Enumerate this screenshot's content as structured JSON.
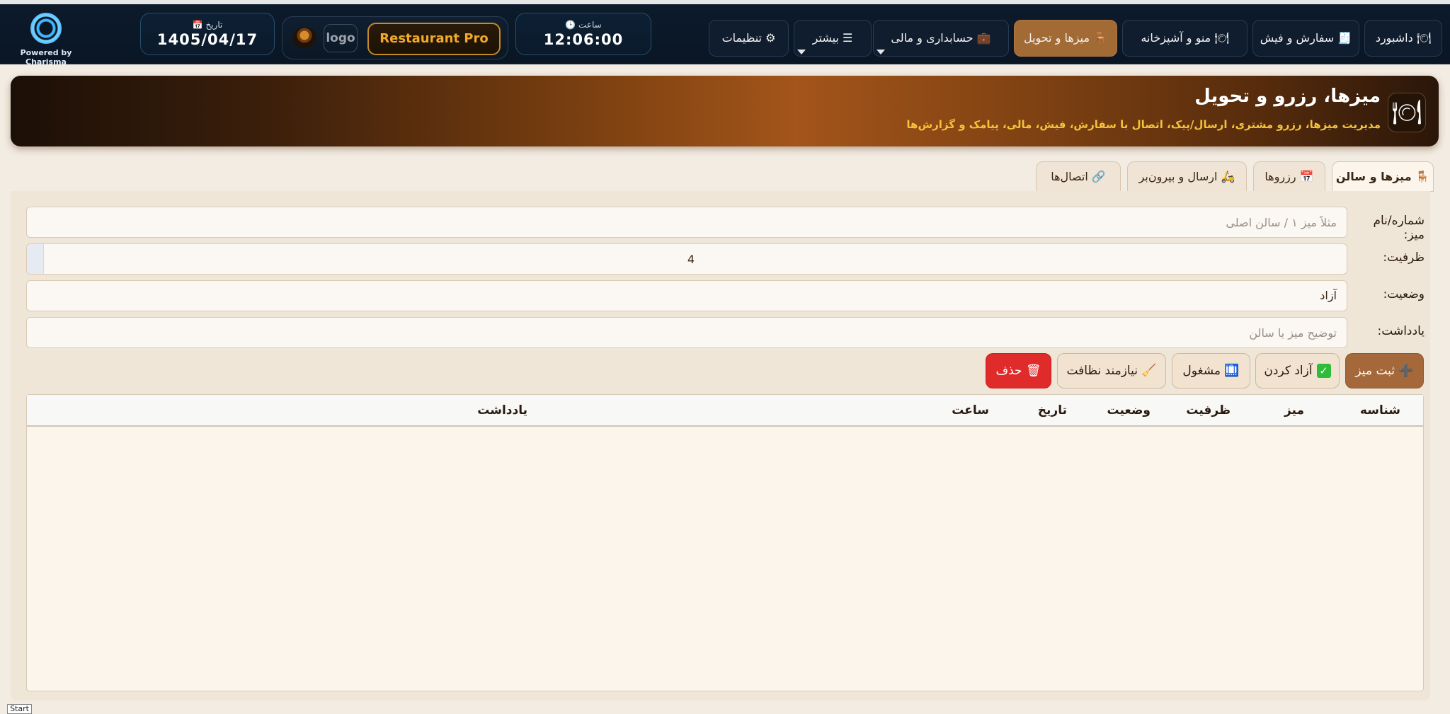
{
  "brand": {
    "powered_by": "Powered by Charisma"
  },
  "date_chip": {
    "label": "📅 تاریخ",
    "value": "1405/04/17"
  },
  "logo_area": {
    "logo_text": "logo",
    "product_name": "Restaurant Pro"
  },
  "clock_chip": {
    "label": "🕒 ساعت",
    "value": "12:06:00"
  },
  "nav": {
    "settings": "⚙ تنظیمات",
    "more": "☰ بیشتر",
    "accounting": "💼 حسابداری و مالی",
    "tables": "🪑 میزها و تحویل",
    "menu_kitchen": "🍽 منو و آشپزخانه",
    "orders": "🧾 سفارش و فیش",
    "dashboard": "🍽 داشبورد"
  },
  "header": {
    "icon": "🍽",
    "title": "میزها، رزرو و تحویل",
    "subtitle": "مدیریت میزها، رزرو مشتری، ارسال/پیک، اتصال با سفارش، فیش، مالی، پیامک و گزارش‌ها"
  },
  "tabs": [
    {
      "label": "🪑 میزها و سالن"
    },
    {
      "label": "📅 رزروها"
    },
    {
      "label": "🛵 ارسال و بیرون‌بر"
    },
    {
      "label": "🔗 اتصال‌ها"
    }
  ],
  "form": {
    "table_name": {
      "label": "شماره/نام میز:",
      "placeholder": "مثلاً میز ۱ / سالن اصلی",
      "value": ""
    },
    "capacity": {
      "label": "ظرفیت:",
      "value": "4"
    },
    "status": {
      "label": "وضعیت:",
      "value": "آزاد"
    },
    "note": {
      "label": "یادداشت:",
      "placeholder": "توضیح میز یا سالن",
      "value": ""
    }
  },
  "actions": {
    "save": "➕ ثبت میز",
    "free": "آزاد کردن",
    "busy": "🛄 مشغول",
    "cleaning": "🧹 نیازمند نظافت",
    "delete": "🗑 حذف"
  },
  "table": {
    "columns": [
      "شناسه",
      "میز",
      "ظرفیت",
      "وضعیت",
      "تاریخ",
      "ساعت",
      "یادداشت"
    ],
    "rows": []
  },
  "taskbar": {
    "start": "Start"
  }
}
